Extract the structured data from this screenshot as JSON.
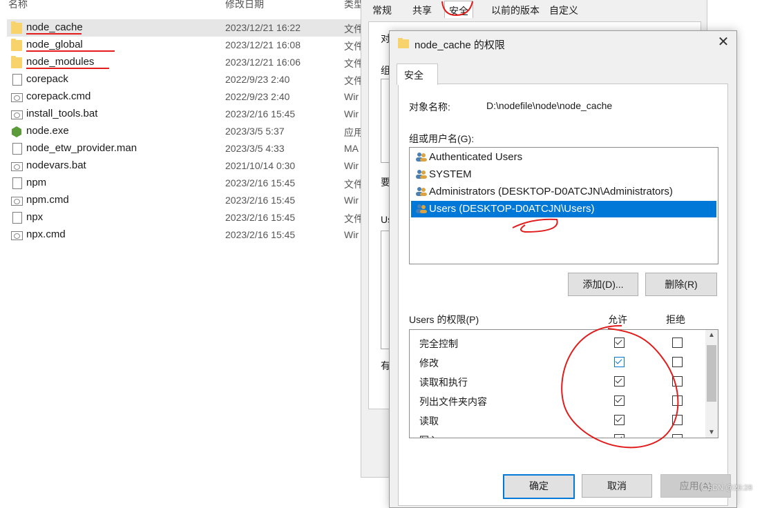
{
  "explorer": {
    "headers": {
      "name": "名称",
      "date": "修改日期",
      "type": "类型"
    },
    "files": [
      {
        "name": "node_cache",
        "date": "2023/12/21 16:22",
        "type": "文件",
        "icon": "folder-icon",
        "selected": true
      },
      {
        "name": "node_global",
        "date": "2023/12/21 16:08",
        "type": "文件",
        "icon": "folder-icon"
      },
      {
        "name": "node_modules",
        "date": "2023/12/21 16:06",
        "type": "文件",
        "icon": "folder-icon"
      },
      {
        "name": "corepack",
        "date": "2022/9/23 2:40",
        "type": "文件",
        "icon": "file-icon"
      },
      {
        "name": "corepack.cmd",
        "date": "2022/9/23 2:40",
        "type": "Wir",
        "icon": "cmd-file-icon"
      },
      {
        "name": "install_tools.bat",
        "date": "2023/2/16 15:45",
        "type": "Wir",
        "icon": "cmd-file-icon"
      },
      {
        "name": "node.exe",
        "date": "2023/3/5 5:37",
        "type": "应用",
        "icon": "node-exe-icon"
      },
      {
        "name": "node_etw_provider.man",
        "date": "2023/3/5 4:33",
        "type": "MA",
        "icon": "file-icon"
      },
      {
        "name": "nodevars.bat",
        "date": "2021/10/14 0:30",
        "type": "Wir",
        "icon": "cmd-file-icon"
      },
      {
        "name": "npm",
        "date": "2023/2/16 15:45",
        "type": "文件",
        "icon": "file-icon"
      },
      {
        "name": "npm.cmd",
        "date": "2023/2/16 15:45",
        "type": "Wir",
        "icon": "cmd-file-icon"
      },
      {
        "name": "npx",
        "date": "2023/2/16 15:45",
        "type": "文件",
        "icon": "file-icon"
      },
      {
        "name": "npx.cmd",
        "date": "2023/2/16 15:45",
        "type": "Wir",
        "icon": "cmd-file-icon"
      }
    ]
  },
  "properties_window": {
    "tabs": [
      "常规",
      "共享",
      "安全",
      "以前的版本",
      "自定义"
    ],
    "active_tab": "安全",
    "partial_labels": {
      "obj": "对",
      "group": "组",
      "need": "要",
      "users": "Us",
      "have": "有"
    }
  },
  "permissions_dialog": {
    "title": "node_cache 的权限",
    "close": "✕",
    "tab": "安全",
    "object_name_label": "对象名称:",
    "object_name_value": "D:\\nodefile\\node\\node_cache",
    "groups_label": "组或用户名(G):",
    "users": [
      {
        "name": "Authenticated Users"
      },
      {
        "name": "SYSTEM"
      },
      {
        "name": "Administrators (DESKTOP-D0ATCJN\\Administrators)"
      },
      {
        "name": "Users (DESKTOP-D0ATCJN\\Users)",
        "selected": true
      }
    ],
    "add_button": "添加(D)...",
    "remove_button": "删除(R)",
    "perm_label": "Users 的权限(P)",
    "allow_header": "允许",
    "deny_header": "拒绝",
    "permissions": [
      {
        "name": "完全控制",
        "allow": true,
        "deny": false
      },
      {
        "name": "修改",
        "allow": true,
        "deny": false,
        "allow_blue": true
      },
      {
        "name": "读取和执行",
        "allow": true,
        "deny": false
      },
      {
        "name": "列出文件夹内容",
        "allow": true,
        "deny": false
      },
      {
        "name": "读取",
        "allow": true,
        "deny": false
      },
      {
        "name": "写入",
        "allow": true,
        "deny": false
      }
    ],
    "ok_button": "确定",
    "cancel_button": "取消",
    "apply_button": "应用(A)"
  },
  "watermark": "CSDN @26:28",
  "colors": {
    "selection": "#0078d7",
    "annotation": "#e21b1b",
    "folder": "#f8d26a"
  }
}
